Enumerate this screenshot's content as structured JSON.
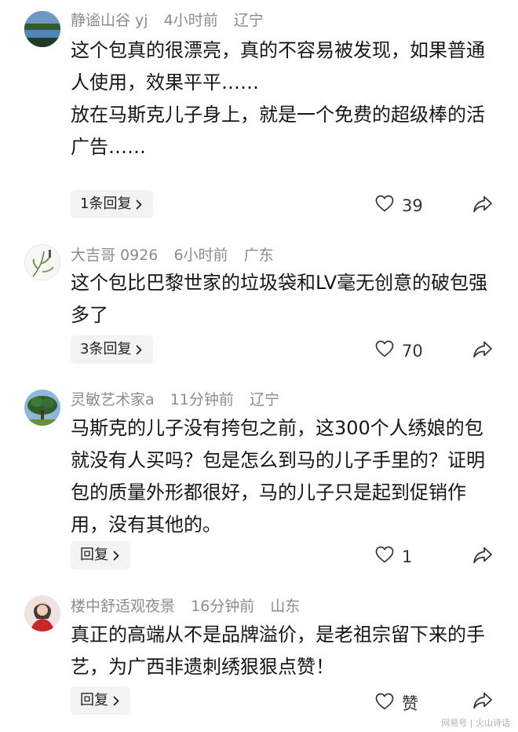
{
  "comments": [
    {
      "username": "静谧山谷 yj",
      "time": "4小时前",
      "location": "辽宁",
      "lines": [
        "这个包真的很漂亮，真的不容易被发现，如果普通人使用，效果平平……",
        "放在马斯克儿子身上，就是一个免费的超级棒的活广告……"
      ],
      "reply_label": "1条回复",
      "likes": "39"
    },
    {
      "username": "大吉哥 0926",
      "time": "6小时前",
      "location": "广东",
      "lines": [
        "这个包比巴黎世家的垃圾袋和LV毫无创意的破包强多了"
      ],
      "reply_label": "3条回复",
      "likes": "70"
    },
    {
      "username": "灵敏艺术家a",
      "time": "11分钟前",
      "location": "辽宁",
      "lines": [
        "马斯克的儿子没有挎包之前，这300个人绣娘的包就没有人买吗？包是怎么到马的儿子手里的？证明包的质量外形都很好，马的儿子只是起到促销作用，没有其他的。"
      ],
      "reply_label": "回复",
      "likes": "1"
    },
    {
      "username": "楼中舒适观夜景",
      "time": "16分钟前",
      "location": "山东",
      "lines": [
        "真正的高端从不是品牌溢价，是老祖宗留下来的手艺，为广西非遗刺绣狠狠点赞！"
      ],
      "reply_label": "回复",
      "likes": "赞"
    }
  ],
  "watermark": "网易号 | 火山诗话",
  "colors": {
    "meta_text": "#8c8c8c",
    "body_text": "#161616",
    "button_bg": "#f3f3f3"
  },
  "icons": {
    "like": "heart-outline-icon",
    "share": "share-arrow-icon",
    "reply_chevron": "chevron-right-icon"
  }
}
